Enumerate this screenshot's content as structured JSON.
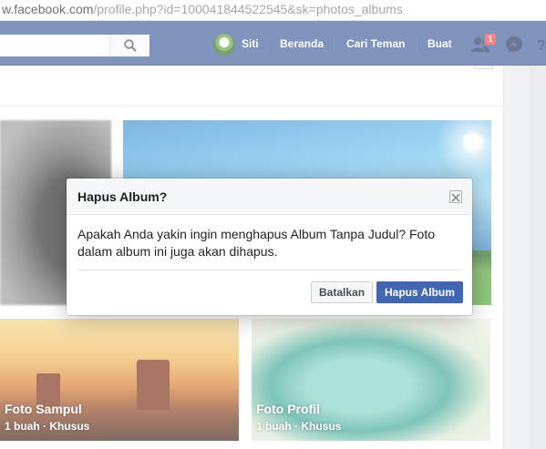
{
  "browser": {
    "url_host": "w.facebook.com",
    "url_rest": "/profile.php?id=100041844522545&sk=photos_albums"
  },
  "topbar": {
    "profile_name": "Siti",
    "nav_home": "Beranda",
    "nav_find_friends": "Cari Teman",
    "nav_create": "Buat",
    "friend_requests_badge": "1",
    "brand_color": "#3b5998"
  },
  "albums": [
    {
      "title": "",
      "subtitle": ""
    },
    {
      "title": "",
      "subtitle": ""
    },
    {
      "title": "Foto Sampul",
      "subtitle": "1 buah · Khusus"
    },
    {
      "title": "Foto Profil",
      "subtitle": "1 buah · Khusus"
    }
  ],
  "dialog": {
    "title": "Hapus Album?",
    "message": "Apakah Anda yakin ingin menghapus Album Tanpa Judul? Foto dalam album ini juga akan dihapus.",
    "cancel_label": "Batalkan",
    "confirm_label": "Hapus Album",
    "confirm_color": "#4267b2"
  }
}
